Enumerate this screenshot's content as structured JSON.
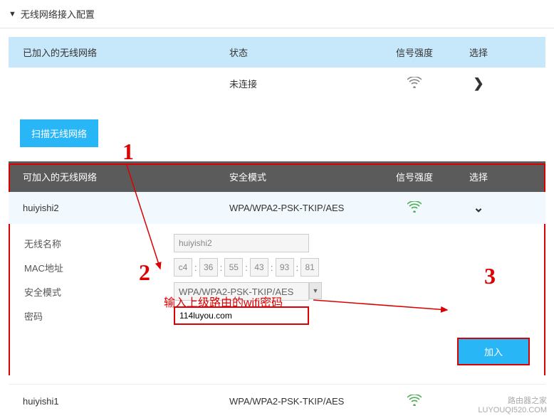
{
  "section_title": "无线网络接入配置",
  "joined_table": {
    "headers": {
      "name": "已加入的无线网络",
      "status": "状态",
      "signal": "信号强度",
      "select": "选择"
    },
    "row": {
      "status": "未连接"
    }
  },
  "scan_button": "扫描无线网络",
  "available_table": {
    "headers": {
      "name": "可加入的无线网络",
      "security": "安全模式",
      "signal": "信号强度",
      "select": "选择"
    },
    "rows": [
      {
        "name": "huiyishi2",
        "security": "WPA/WPA2-PSK-TKIP/AES",
        "signal": "strong"
      },
      {
        "name": "huiyishi1",
        "security": "WPA/WPA2-PSK-TKIP/AES",
        "signal": "strong"
      }
    ]
  },
  "form": {
    "ssid_label": "无线名称",
    "ssid_value": "huiyishi2",
    "mac_label": "MAC地址",
    "mac": [
      "c4",
      "36",
      "55",
      "43",
      "93",
      "81"
    ],
    "security_label": "安全模式",
    "security_value": "WPA/WPA2-PSK-TKIP/AES",
    "password_label": "密码",
    "password_value": "114luyou.com",
    "join_button": "加入"
  },
  "annotations": {
    "num1": "1",
    "num2": "2",
    "num3": "3",
    "hint": "输入上级路由的wifi密码"
  },
  "watermark": {
    "line1": "路由器之家",
    "line2": "LUYOUQI520.COM"
  }
}
